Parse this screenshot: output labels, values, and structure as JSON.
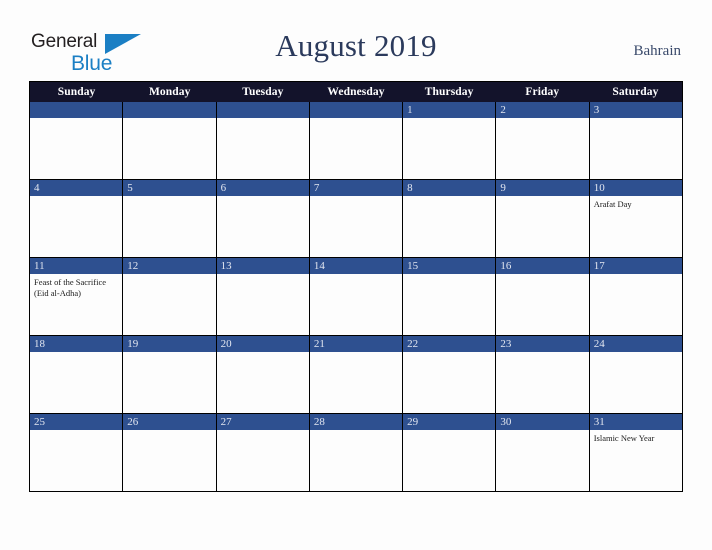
{
  "logo": {
    "word_one": "General",
    "word_two": "Blue",
    "triangle_color": "#1b7fc4",
    "icon": "triangle-icon"
  },
  "header": {
    "title": "August 2019",
    "region": "Bahrain"
  },
  "theme": {
    "header_row_bg": "#13132b",
    "date_bar_bg": "#2e5090",
    "date_text": "#e2e6f0",
    "title_color": "#2b3a5c",
    "page_bg": "#fdfdfd",
    "grid_line": "#000000"
  },
  "calendar": {
    "month": "August",
    "year": "2019",
    "weekdays": [
      "Sunday",
      "Monday",
      "Tuesday",
      "Wednesday",
      "Thursday",
      "Friday",
      "Saturday"
    ],
    "weeks": [
      [
        {
          "date": "",
          "events": []
        },
        {
          "date": "",
          "events": []
        },
        {
          "date": "",
          "events": []
        },
        {
          "date": "",
          "events": []
        },
        {
          "date": "1",
          "events": []
        },
        {
          "date": "2",
          "events": []
        },
        {
          "date": "3",
          "events": []
        }
      ],
      [
        {
          "date": "4",
          "events": []
        },
        {
          "date": "5",
          "events": []
        },
        {
          "date": "6",
          "events": []
        },
        {
          "date": "7",
          "events": []
        },
        {
          "date": "8",
          "events": []
        },
        {
          "date": "9",
          "events": []
        },
        {
          "date": "10",
          "events": [
            "Arafat Day"
          ]
        }
      ],
      [
        {
          "date": "11",
          "events": [
            "Feast of the Sacrifice (Eid al-Adha)"
          ]
        },
        {
          "date": "12",
          "events": []
        },
        {
          "date": "13",
          "events": []
        },
        {
          "date": "14",
          "events": []
        },
        {
          "date": "15",
          "events": []
        },
        {
          "date": "16",
          "events": []
        },
        {
          "date": "17",
          "events": []
        }
      ],
      [
        {
          "date": "18",
          "events": []
        },
        {
          "date": "19",
          "events": []
        },
        {
          "date": "20",
          "events": []
        },
        {
          "date": "21",
          "events": []
        },
        {
          "date": "22",
          "events": []
        },
        {
          "date": "23",
          "events": []
        },
        {
          "date": "24",
          "events": []
        }
      ],
      [
        {
          "date": "25",
          "events": []
        },
        {
          "date": "26",
          "events": []
        },
        {
          "date": "27",
          "events": []
        },
        {
          "date": "28",
          "events": []
        },
        {
          "date": "29",
          "events": []
        },
        {
          "date": "30",
          "events": []
        },
        {
          "date": "31",
          "events": [
            "Islamic New Year"
          ]
        }
      ]
    ]
  }
}
